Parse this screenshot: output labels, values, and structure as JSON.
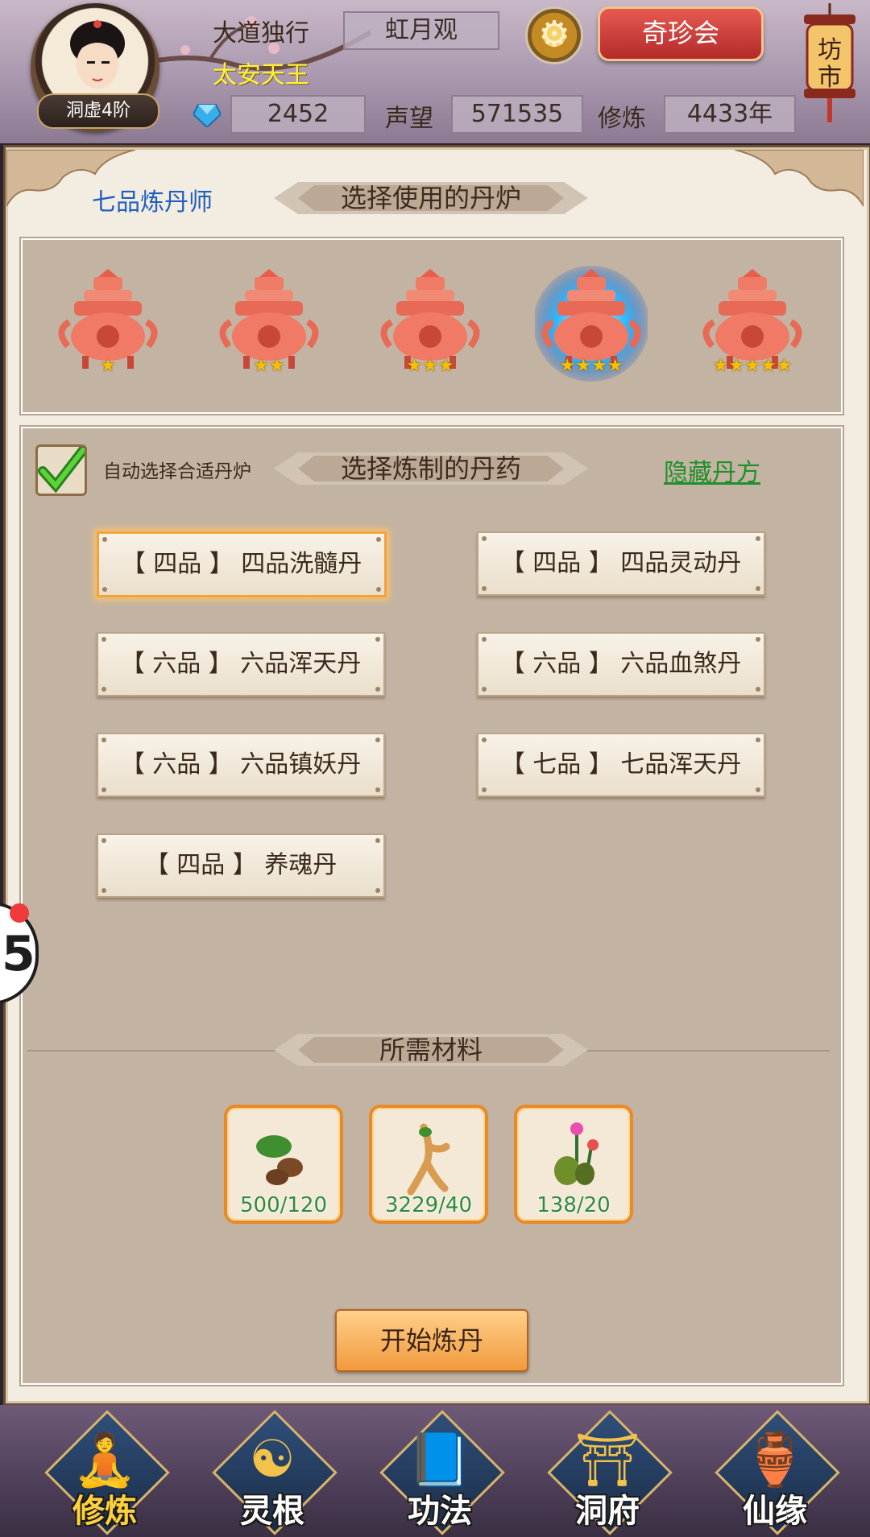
{
  "header": {
    "player_name": "大道独行",
    "title": "太安天王",
    "rank": "洞虚4阶",
    "location": "虹月观",
    "treasure_button": "奇珍会",
    "market_sign": "坊市",
    "gems": "2452",
    "reputation_label": "声望",
    "reputation": "571535",
    "cultivation_label": "修炼",
    "cultivation": "4433年"
  },
  "panel": {
    "alchemist_rank": "七品炼丹师",
    "furnace_heading": "选择使用的丹炉",
    "furnaces": [
      {
        "stars": 1,
        "selected": false
      },
      {
        "stars": 2,
        "selected": false
      },
      {
        "stars": 3,
        "selected": false
      },
      {
        "stars": 4,
        "selected": true
      },
      {
        "stars": 5,
        "selected": false
      }
    ],
    "auto_select_label": "自动选择合适丹炉",
    "auto_select_checked": true,
    "pill_heading": "选择炼制的丹药",
    "hide_recipes_link": "隐藏丹方",
    "recipes": [
      {
        "label": "【 四品 】 四品洗髓丹",
        "selected": true
      },
      {
        "label": "【 四品 】 四品灵动丹",
        "selected": false
      },
      {
        "label": "【 六品 】 六品浑天丹",
        "selected": false
      },
      {
        "label": "【 六品 】 六品血煞丹",
        "selected": false
      },
      {
        "label": "【 六品 】 六品镇妖丹",
        "selected": false
      },
      {
        "label": "【 七品 】 七品浑天丹",
        "selected": false
      },
      {
        "label": "【 四品 】 养魂丹",
        "selected": false
      }
    ],
    "materials_heading": "所需材料",
    "materials": [
      {
        "icon": "herb-root-icon",
        "count": "500/120"
      },
      {
        "icon": "ginseng-icon",
        "count": "3229/40"
      },
      {
        "icon": "flower-plant-icon",
        "count": "138/20"
      }
    ],
    "start_button": "开始炼丹"
  },
  "side_tab": {
    "label": "5"
  },
  "bottom_nav": [
    {
      "label": "修炼",
      "icon": "monk-icon",
      "active": true
    },
    {
      "label": "灵根",
      "icon": "yin-yang-sword-icon",
      "active": false
    },
    {
      "label": "功法",
      "icon": "book-icon",
      "active": false
    },
    {
      "label": "洞府",
      "icon": "pavilion-icon",
      "active": false
    },
    {
      "label": "仙缘",
      "icon": "gourd-icon",
      "active": false
    }
  ],
  "colors": {
    "accent_orange": "#f3a33a",
    "link_green": "#1f8f2a",
    "rank_blue": "#1f5fbf",
    "title_yellow": "#fff23a"
  }
}
